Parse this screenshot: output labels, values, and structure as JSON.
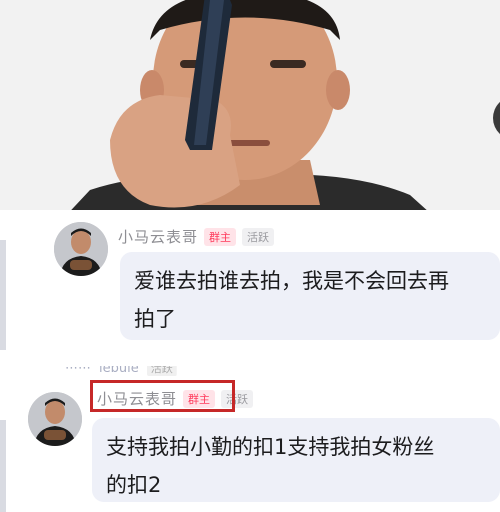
{
  "video": {
    "description_icon": "phone-icon"
  },
  "messages": [
    {
      "sender": "小马云表哥",
      "owner_badge": "群主",
      "active_badge": "活跃",
      "text_line1": "爱谁去拍谁去拍，我是不会回去再",
      "text_line2": "拍了"
    },
    {
      "sender": "小马云表哥",
      "owner_badge": "群主",
      "active_badge": "活跃",
      "text_line1": "支持我拍小勤的扣1支持我拍女粉丝",
      "text_line2": "的扣2"
    }
  ],
  "ghost_row": {
    "prefix": "⋯⋯",
    "name": "lebule",
    "badge": "活跃"
  }
}
